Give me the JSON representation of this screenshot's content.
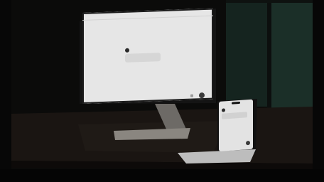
{
  "scene": {
    "description_free": true
  },
  "monitor": {
    "window_title": "",
    "chat_name": "",
    "message_line_1": "",
    "message_line_2": ""
  },
  "phone": {
    "chat_name": "",
    "message_line_1": ""
  },
  "colors": {
    "wall_dark": "#0b0b0a",
    "window_green": "#1f3a30",
    "desk_top": "#1a1512",
    "screen_bg": "#e6e6e6",
    "stand_metal": "#8a8680"
  },
  "icons": {
    "monitor_send": "circle-icon",
    "phone_send": "circle-icon",
    "monitor_avatar": "avatar",
    "phone_avatar": "avatar"
  }
}
